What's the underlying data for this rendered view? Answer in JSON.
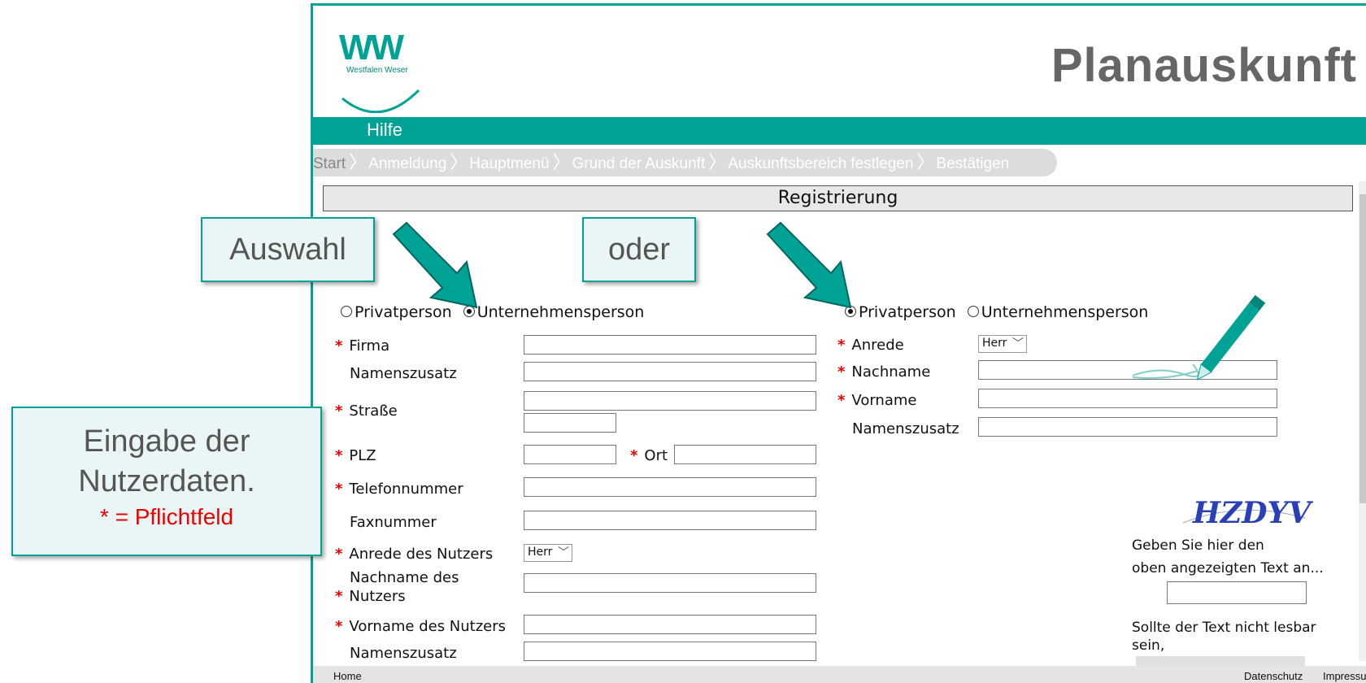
{
  "app": {
    "logo_text": "WW",
    "logo_sub": "Westfalen Weser",
    "title": "Planauskunft"
  },
  "nav": {
    "help_label": "Hilfe"
  },
  "breadcrumb": [
    "Start",
    "Anmeldung",
    "Hauptmenü",
    "Grund der Auskunft",
    "Auskunftsbereich festlegen",
    "Bestätigen"
  ],
  "section_title": "Registrierung",
  "left_form": {
    "radio_private": "Privatperson",
    "radio_company": "Unternehmensperson",
    "selected": "Unternehmensperson",
    "required_mark": "*",
    "fields": {
      "firma": "Firma",
      "namenszusatz": "Namenszusatz",
      "strasse": "Straße",
      "plz": "PLZ",
      "ort": "Ort",
      "telefon": "Telefonnummer",
      "fax": "Faxnummer",
      "anrede_nutzer": "Anrede des Nutzers",
      "nachname_nutzer_1": "Nachname des",
      "nachname_nutzer_2": "Nutzers",
      "vorname_nutzer": "Vorname des Nutzers",
      "namenszusatz_nutzer": "Namenszusatz"
    },
    "anrede_value": "Herr"
  },
  "right_form": {
    "radio_private": "Privatperson",
    "radio_company": "Unternehmensperson",
    "selected": "Privatperson",
    "fields": {
      "anrede": "Anrede",
      "nachname": "Nachname",
      "vorname": "Vorname",
      "namenszusatz": "Namenszusatz"
    },
    "anrede_value": "Herr"
  },
  "captcha": {
    "image_text": "HZDYV",
    "prompt_1": "Geben Sie hier den",
    "prompt_2": "oben angezeigten Text an...",
    "unreadable_1": "Sollte der Text nicht lesbar",
    "unreadable_2": "sein,"
  },
  "footer": {
    "home": "Home",
    "privacy": "Datenschutz",
    "imprint": "Impressu"
  },
  "callouts": {
    "auswahl": "Auswahl",
    "oder": "oder",
    "eingabe_1": "Eingabe der",
    "eingabe_2": "Nutzerdaten.",
    "pflicht": "* = Pflichtfeld"
  },
  "colors": {
    "brand": "#00a296",
    "required": "#e00000",
    "title_gray": "#666666"
  }
}
